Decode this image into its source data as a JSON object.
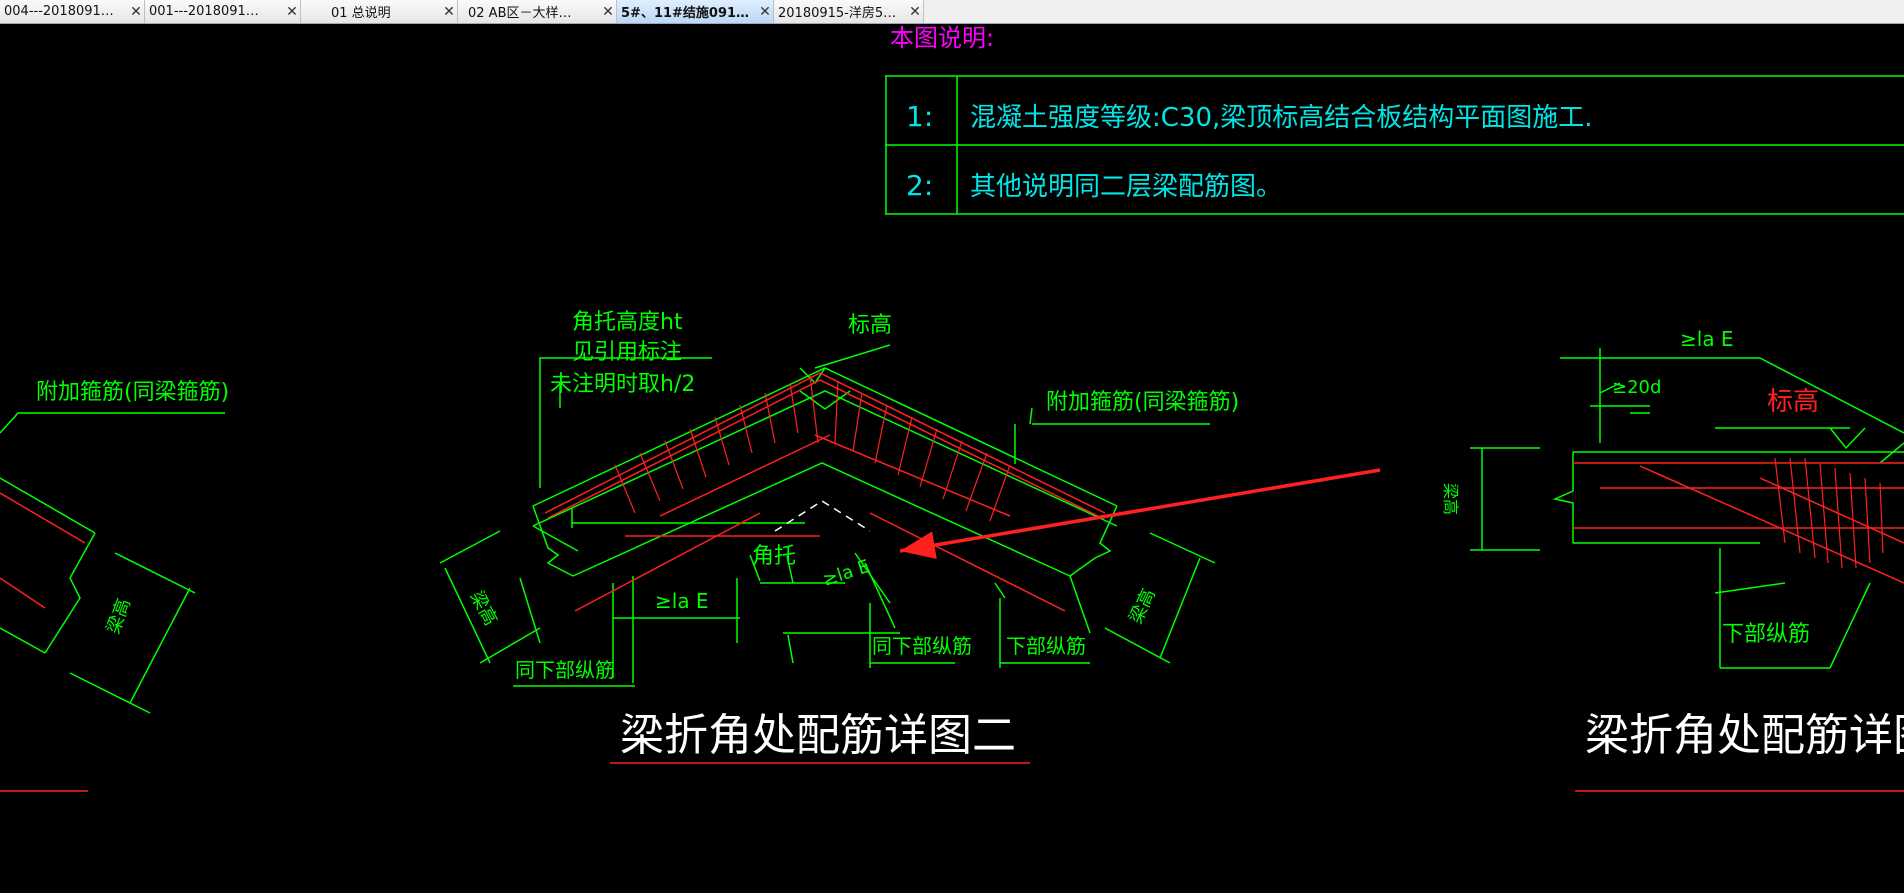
{
  "tabs": [
    {
      "label": "004---2018091…",
      "active": false
    },
    {
      "label": "001---2018091…",
      "active": false
    },
    {
      "label": "  01    总说明",
      "active": false
    },
    {
      "label": "02    AB区－大样…",
      "active": false
    },
    {
      "label": "5#、11#结施091…",
      "active": true
    },
    {
      "label": "20180915-洋房5…",
      "active": false
    }
  ],
  "close_glyph": "✕",
  "colors": {
    "green": "#00ff00",
    "red": "#ff2020",
    "cyan": "#00e5e5",
    "magenta": "#ff00ff",
    "white": "#ffffff",
    "background": "#000000"
  },
  "notes": {
    "title": "本图说明:",
    "rows": [
      {
        "num": "1:",
        "text": "混凝土强度等级:C30,梁顶标高结合板结构平面图施工."
      },
      {
        "num": "2:",
        "text": "其他说明同二层梁配筋图。"
      }
    ]
  },
  "left_detail": {
    "label_stirrup": "附加箍筋(同梁箍筋)",
    "label_height": "梁高"
  },
  "center_detail": {
    "label_haunch_height": "角托高度ht",
    "label_see_ref": "见引用标注",
    "label_default": "未注明时取h/2",
    "label_elevation": "标高",
    "label_stirrup": "附加箍筋(同梁箍筋)",
    "label_haunch": "角托",
    "label_lae_1": "≥la E",
    "label_lae_2": "≥la E",
    "label_same_bottom_1": "同下部纵筋",
    "label_same_bottom_2": "同下部纵筋",
    "label_bottom": "下部纵筋",
    "label_height_left": "梁高",
    "label_height_right": "梁高",
    "title": "梁折角处配筋详图二"
  },
  "right_detail": {
    "label_lae": "≥la E",
    "label_20d": "≥20d",
    "label_elevation": "标高",
    "label_height": "梁高",
    "label_bottom": "下部纵筋",
    "title": "梁折角处配筋详图三"
  }
}
